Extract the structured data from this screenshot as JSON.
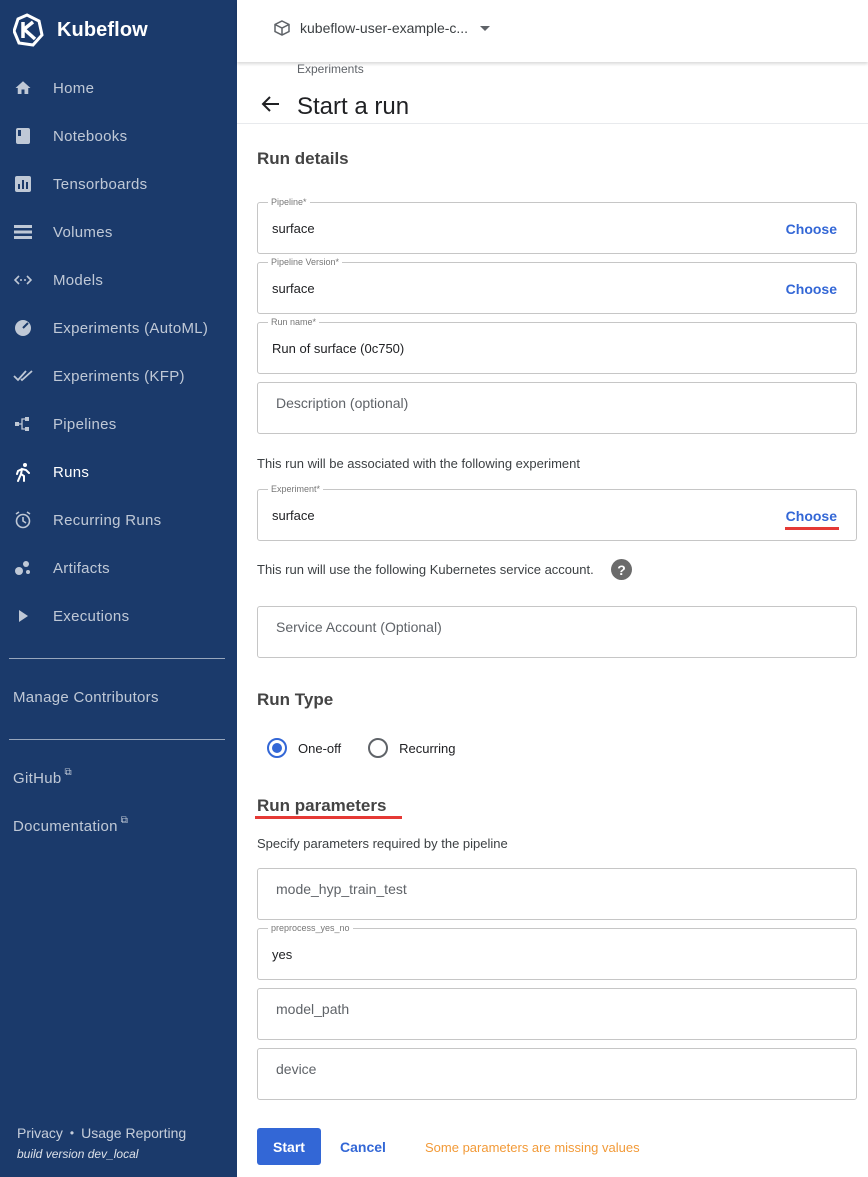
{
  "app": {
    "name": "Kubeflow"
  },
  "sidebar": {
    "items": [
      {
        "label": "Home",
        "icon": "home-icon"
      },
      {
        "label": "Notebooks",
        "icon": "notebook-icon"
      },
      {
        "label": "Tensorboards",
        "icon": "chart-icon"
      },
      {
        "label": "Volumes",
        "icon": "storage-icon"
      },
      {
        "label": "Models",
        "icon": "code-arrows-icon"
      },
      {
        "label": "Experiments (AutoML)",
        "icon": "speedometer-icon"
      },
      {
        "label": "Experiments (KFP)",
        "icon": "double-check-icon"
      },
      {
        "label": "Pipelines",
        "icon": "pipeline-icon"
      },
      {
        "label": "Runs",
        "icon": "runner-icon"
      },
      {
        "label": "Recurring Runs",
        "icon": "alarm-icon"
      },
      {
        "label": "Artifacts",
        "icon": "bubbles-icon"
      },
      {
        "label": "Executions",
        "icon": "play-icon"
      }
    ],
    "active": "Runs",
    "manage_contributors": "Manage Contributors",
    "github": "GitHub",
    "documentation": "Documentation",
    "footer": {
      "privacy": "Privacy",
      "usage_reporting": "Usage Reporting",
      "build": "build version dev_local"
    }
  },
  "topbar": {
    "namespace": "kubeflow-user-example-c..."
  },
  "page": {
    "breadcrumb": "Experiments",
    "title": "Start a run",
    "run_details_title": "Run details",
    "pipeline": {
      "label": "Pipeline*",
      "value": "surface",
      "action": "Choose"
    },
    "pipeline_version": {
      "label": "Pipeline Version*",
      "value": "surface",
      "action": "Choose"
    },
    "run_name": {
      "label": "Run name*",
      "value": "Run of surface (0c750)"
    },
    "description": {
      "placeholder": "Description (optional)"
    },
    "experiment_note": "This run will be associated with the following experiment",
    "experiment": {
      "label": "Experiment*",
      "value": "surface",
      "action": "Choose"
    },
    "service_account_note": "This run will use the following Kubernetes service account.",
    "service_account": {
      "placeholder": "Service Account (Optional)"
    },
    "run_type_title": "Run Type",
    "run_type": {
      "options": [
        "One-off",
        "Recurring"
      ],
      "selected": "One-off"
    },
    "params_title": "Run parameters",
    "params_note": "Specify parameters required by the pipeline",
    "params": [
      {
        "name": "mode_hyp_train_test",
        "value": ""
      },
      {
        "name": "preprocess_yes_no",
        "value": "yes"
      },
      {
        "name": "model_path",
        "value": ""
      },
      {
        "name": "device",
        "value": ""
      }
    ],
    "start": "Start",
    "cancel": "Cancel",
    "warning": "Some parameters are missing values"
  },
  "colors": {
    "sidebar": "#1b3a6b",
    "accent": "#3367d6",
    "warning": "#f29a38",
    "highlight": "#e53935"
  }
}
